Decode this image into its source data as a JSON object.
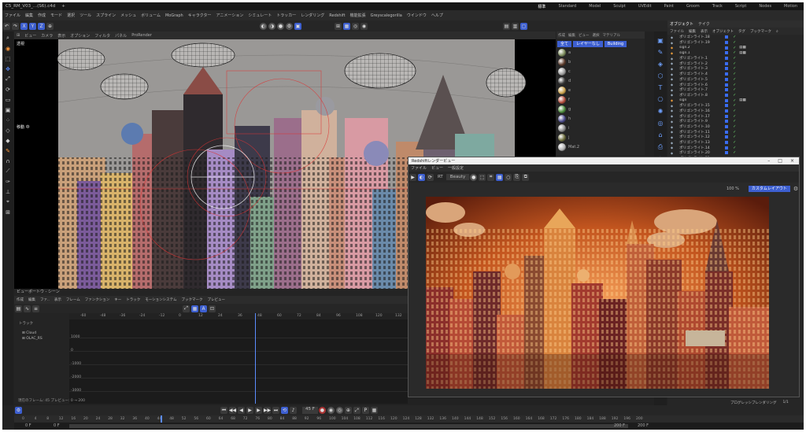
{
  "window": {
    "title": "C5_RM_V03_...(S6).c4d",
    "plus": "+"
  },
  "menu": [
    "ファイル",
    "編集",
    "作成",
    "モード",
    "選択",
    "ツール",
    "スプライン",
    "メッシュ",
    "ボリューム",
    "MoGraph",
    "キャラクター",
    "アニメーション",
    "シミュレート",
    "トラッカー",
    "レンダリング",
    "Redshift",
    "機能拡張",
    "Greyscalegorilla",
    "ウインドウ",
    "ヘルプ"
  ],
  "layouts": [
    "標準",
    "Standard",
    "Model",
    "Sculpt",
    "UVEdit",
    "Paint",
    "Groom",
    "Track",
    "Script",
    "Nodes",
    "Motion"
  ],
  "active_layout": "標準",
  "toolbar_left": [
    "X",
    "Y",
    "Z"
  ],
  "viewport": {
    "menu": [
      "ビュー",
      "カメラ",
      "表示",
      "オプション",
      "フィルタ",
      "パネル",
      "ProRender"
    ],
    "label": "透視",
    "side_label": "移動 中",
    "status": "ビューポートウ - シーン"
  },
  "side_strip": {
    "menu": [
      "作成",
      "編集",
      "ビュー",
      "選択",
      "マテリアル"
    ],
    "tabs": [
      "全て",
      "レイヤーなし",
      "Building"
    ],
    "materials": [
      "a",
      "b",
      "c",
      "d",
      "e",
      "f",
      "g",
      "h",
      "i",
      "j",
      "Mat.2"
    ]
  },
  "object_manager": {
    "tabs": [
      "オブジェクト",
      "テイク"
    ],
    "menu": [
      "ファイル",
      "編集",
      "表示",
      "オブジェクト",
      "タグ",
      "ブックマーク"
    ],
    "rows": [
      "ポリゴンライト.18",
      "ポリゴンライト.19",
      "sign.2",
      "sign.1",
      "ポリゴンライト.1",
      "ポリゴンライト.2",
      "ポリゴンライト.3",
      "ポリゴンライト.4",
      "ポリゴンライト.5",
      "ポリゴンライト.6",
      "ポリゴンライト.7",
      "ポリゴンライト.8",
      "sign",
      "ポリゴンライト.15",
      "ポリゴンライト.16",
      "ポリゴンライト.17",
      "ポリゴンライト.9",
      "ポリゴンライト.10",
      "ポリゴンライト.11",
      "ポリゴンライト.12",
      "ポリゴンライト.13",
      "ポリゴンライト.14",
      "ポリゴンライト.20",
      "ポリゴンライト.21",
      "ポリゴンライト.22",
      "ポリゴンライト.23",
      "ポリゴンライト.24",
      "ポリゴンライト.25"
    ],
    "progress_label": "プログレッシブレンダリング",
    "progress_value": "1/1"
  },
  "render_view": {
    "title": "Redshiftレンダービュー",
    "menu": [
      "ファイル",
      "ビュー",
      "一般設定"
    ],
    "rt": "RT",
    "beauty": "Beauty",
    "zoom": "100 %",
    "preset": "カスタムレイアウト"
  },
  "timeline": {
    "menu": [
      "作成",
      "編集",
      "ファ..",
      "表示",
      "フレーム",
      "ファンクション",
      "キー",
      "トラック",
      "モーションシステム",
      "ブックマーク",
      "プレビュー"
    ],
    "ruler": [
      "-60",
      "-48",
      "-36",
      "-24",
      "-12",
      "0",
      "12",
      "24",
      "36",
      "48",
      "60",
      "72",
      "84",
      "96",
      "108",
      "120",
      "132"
    ],
    "tracks": [
      "Cloud",
      "OLAC_RS"
    ],
    "yvals": [
      "1000",
      "0",
      "-1000",
      "-2000",
      "-3000"
    ],
    "status": "現在のフレーム: 45  プレビュー: 0 → 200"
  },
  "transport": {
    "frame": "45 F"
  },
  "bottom_ruler": [
    "0",
    "4",
    "8",
    "12",
    "16",
    "20",
    "24",
    "28",
    "32",
    "36",
    "40",
    "44",
    "48",
    "52",
    "56",
    "60",
    "64",
    "68",
    "72",
    "76",
    "80",
    "84",
    "88",
    "92",
    "96",
    "100",
    "104",
    "108",
    "112",
    "116",
    "120",
    "124",
    "128",
    "132",
    "136",
    "140",
    "144",
    "148",
    "152",
    "156",
    "160",
    "164",
    "168",
    "172",
    "176",
    "180",
    "184",
    "188",
    "192",
    "196",
    "200"
  ],
  "frame_fields": {
    "start": "0 F",
    "min": "0 F",
    "max": "200 F",
    "end": "200 F"
  },
  "colors": {
    "accent": "#3d5fd0",
    "check": "#6cd46c",
    "bg": "#222222"
  }
}
